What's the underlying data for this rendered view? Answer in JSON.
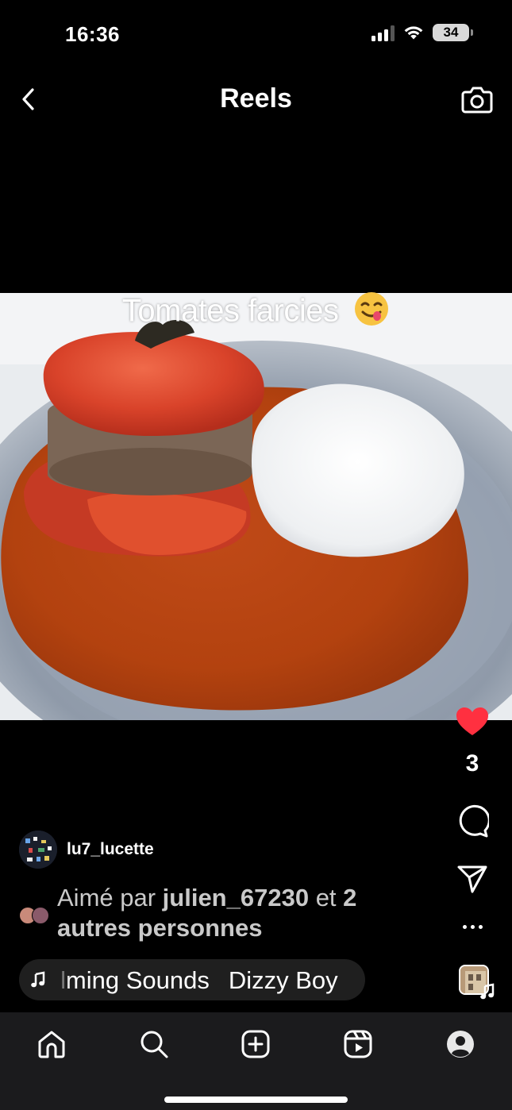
{
  "status_bar": {
    "time": "16:36",
    "battery_level": "34",
    "signal_bars_active": 3,
    "signal_bars_total": 4
  },
  "header": {
    "title": "Reels",
    "back_icon": "chevron-left-icon",
    "camera_icon": "camera-icon"
  },
  "media": {
    "overlay_caption": "Tomates farcies",
    "overlay_emoji": "face-savoring-food-emoji"
  },
  "actions": {
    "like_icon": "heart-filled-icon",
    "like_color": "#ff3040",
    "like_count": "3",
    "comment_icon": "comment-bubble-icon",
    "share_icon": "paper-plane-icon",
    "more_icon": "more-horizontal-icon"
  },
  "author": {
    "username": "lu7_lucette"
  },
  "liked_by": {
    "prefix": "Aimé par ",
    "user": "julien_67230",
    "middle": " et ",
    "others": "2 autres personnes"
  },
  "audio": {
    "icon": "music-note-icon",
    "track_name": "lming Sounds",
    "artist": "Dizzy Boy"
  },
  "bottom_nav": {
    "items": [
      {
        "name": "home",
        "icon": "home-icon"
      },
      {
        "name": "search",
        "icon": "search-icon"
      },
      {
        "name": "create",
        "icon": "plus-square-icon"
      },
      {
        "name": "reels",
        "icon": "reels-icon"
      },
      {
        "name": "profile",
        "icon": "profile-icon"
      }
    ]
  }
}
